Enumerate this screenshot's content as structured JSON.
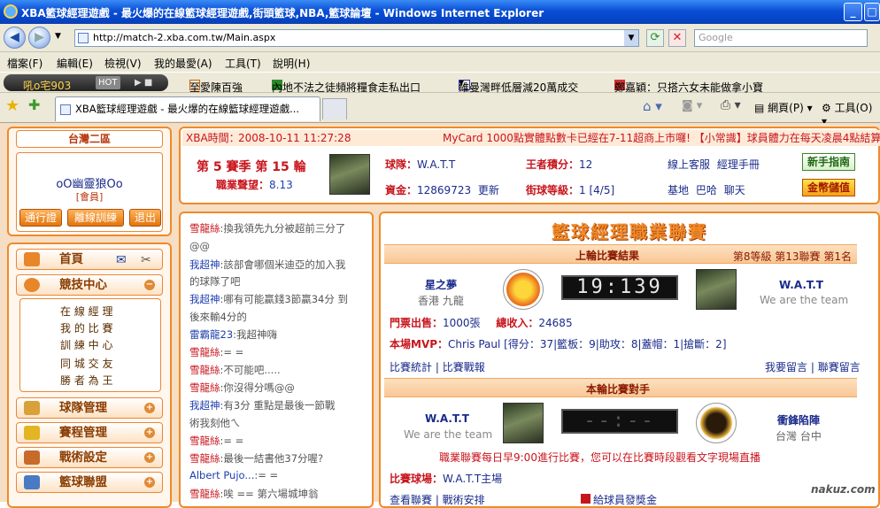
{
  "window": {
    "title": "XBA籃球經理遊戲 - 最火爆的在線籃球經理遊戲,街頭籃球,NBA,籃球論壇 - Windows Internet Explorer"
  },
  "browser": {
    "url": "http://match-2.xba.com.tw/Main.aspx",
    "search_placeholder": "Google",
    "menu": [
      "檔案(F)",
      "編輯(E)",
      "檢視(V)",
      "我的最愛(A)",
      "工具(T)",
      "說明(H)"
    ],
    "links_badge": "吼o宅903",
    "links_hot": "HOT",
    "links": [
      "至愛陳百強",
      "內地不法之徒頻將糧食走私出口",
      "維曼灣畔低層減20萬成交",
      "鄭嘉穎：只搭六女未能做拿小寶"
    ],
    "tab_title": "XBA籃球經理遊戲 - 最火爆的在線籃球經理遊戲...",
    "tools": {
      "page": "網頁(P)",
      "tools": "工具(O)"
    }
  },
  "sidebar": {
    "region": "台灣二區",
    "username": "oO幽靈狼Oo",
    "member_type": "[會員]",
    "buttons": [
      "通行證",
      "離線訓練",
      "退出"
    ],
    "home": "首頁",
    "section": "競技中心",
    "sub_items": [
      "在 線 經 理",
      "我 的 比 賽",
      "訓 練 中 心",
      "同 城 交 友",
      "勝 者 為 王"
    ],
    "nav": [
      "球隊管理",
      "賽程管理",
      "戰術設定",
      "籃球聯盟"
    ]
  },
  "header": {
    "time_label": "XBA時間：",
    "time": "2008-10-11 11:27:28",
    "marquee": "MyCard 1000點實體點數卡已經在7-11超商上市囉! 【小常識】球員體力在每天凌晨4點結算",
    "season": "第 5 賽季 第 15 輪",
    "rep_label": "職業聲望：",
    "rep_value": "8.13",
    "team_label": "球隊：",
    "team_value": "W.A.T.T",
    "king_label": "王者積分：",
    "king_value": "12",
    "cs_label": "線上客服",
    "cs_link": "經理手冊",
    "funds_label": "資金：",
    "funds_value": "12869723",
    "update": "更新",
    "level_label": "街球等級：",
    "level_value": "1 [4/5]",
    "base": "基地",
    "bar": "巴哈",
    "chat": "聊天",
    "btn_guide": "新手指南",
    "btn_gold": "金幣儲值"
  },
  "chat": [
    {
      "name": "雪龍絲",
      "text": ":換我領先九分被超前三分了"
    },
    {
      "name": "",
      "text": "@@"
    },
    {
      "name": "我超神",
      "text": ":該部會哪個米迪亞的加入我"
    },
    {
      "name": "",
      "text": "的球隊了吧"
    },
    {
      "name": "我超神",
      "text": ":哪有可能贏錢3節贏34分  到"
    },
    {
      "name": "",
      "text": "後來輸4分的"
    },
    {
      "name": "雷霸龍23",
      "text": ":我超神嗨"
    },
    {
      "name": "雪龍絲",
      "text": ":= ="
    },
    {
      "name": "雪龍絲",
      "text": ":不可能吧....."
    },
    {
      "name": "雪龍絲",
      "text": ":你沒得分嗎@@"
    },
    {
      "name": "我超神",
      "text": ":有3分      重點是最後一節戰"
    },
    {
      "name": "",
      "text": "術我刻他ㄟ"
    },
    {
      "name": "雪龍絲",
      "text": ":= ="
    },
    {
      "name": "雪龍絲",
      "text": ":最後一結書他37分喔?"
    },
    {
      "name": "Albert Pujo...",
      "text": ":=      ="
    },
    {
      "name": "雪龍絲",
      "text": ":唉  == 第六場城坤翁"
    }
  ],
  "league": {
    "title": "籃球經理職業聯賽",
    "last_result": "上輪比賽結果",
    "level_info": "第8等級 第13聯賽 第1名",
    "home_team": "星之夢",
    "home_city": "香港 九龍",
    "score": "19:139",
    "away_team": "W.A.T.T",
    "away_slogan": "We are the team",
    "ticket_label": "門票出售：",
    "ticket_value": "1000張",
    "income_label": "總收入：",
    "income_value": "24685",
    "mvp_label": "本場MVP：",
    "mvp_value": "Chris Paul [得分：37|籃板：9|助攻：8|蓋帽：1|搶斷：2]",
    "stats_link": "比賽統計",
    "report_link": "比賽戰報",
    "msg_link": "我要留言",
    "msgboard_link": "聯賽留言",
    "next_title": "本輪比賽對手",
    "next_home": "W.A.T.T",
    "next_home_slogan": "We are the team",
    "next_score": "--:--",
    "next_away": "衝鋒陷陣",
    "next_away_city": "台灣 台中",
    "notice": "職業聯賽每日早9:00進行比賽，您可以在比賽時段觀看文字現場直播",
    "venue_label": "比賽球場：",
    "venue_value": "W.A.T.T主場",
    "bottom_left": "查看聯賽 | 戰術安排",
    "bottom_right": "給球員發獎金",
    "watermark": "nakuz.com"
  }
}
